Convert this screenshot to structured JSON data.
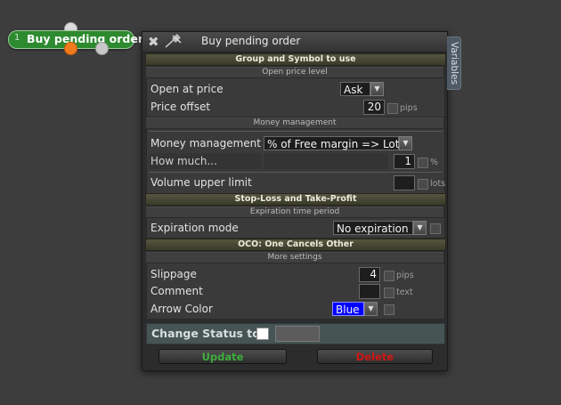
{
  "node": {
    "number": "1",
    "title": "Buy pending order"
  },
  "dialog": {
    "title": "Buy pending order",
    "variables_tab": "Variables",
    "sections": {
      "group_symbol": "Group and Symbol to use",
      "open_price_level": "Open price level",
      "money_management": "Money management",
      "sl_tp": "Stop-Loss and Take-Profit",
      "expiration_period": "Expiration time period",
      "oco": "OCO: One Cancels Other",
      "more_settings": "More settings"
    },
    "fields": {
      "open_at_price": {
        "label": "Open at price",
        "value": "Ask"
      },
      "price_offset": {
        "label": "Price offset",
        "value": "20",
        "unit": "pips"
      },
      "money_management": {
        "label": "Money management",
        "value": "% of Free margin => Lots"
      },
      "how_much": {
        "label": "How much...",
        "value": "1",
        "unit": "%"
      },
      "volume_upper_limit": {
        "label": "Volume upper limit",
        "value": "",
        "unit": "lots"
      },
      "expiration_mode": {
        "label": "Expiration mode",
        "value": "No expiration"
      },
      "slippage": {
        "label": "Slippage",
        "value": "4",
        "unit": "pips"
      },
      "comment": {
        "label": "Comment",
        "value": "",
        "unit": "text"
      },
      "arrow_color": {
        "label": "Arrow Color",
        "value": "Blue",
        "color": "#0000ff"
      }
    },
    "status": {
      "label": "Change Status to"
    },
    "buttons": {
      "update": "Update",
      "delete": "Delete"
    },
    "colors": {
      "update_text": "#3fae3f",
      "delete_text": "#d01616",
      "node_green": "#2d8a2f"
    }
  }
}
